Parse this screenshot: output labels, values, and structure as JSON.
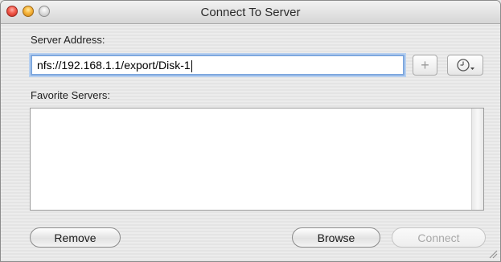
{
  "window": {
    "title": "Connect To Server"
  },
  "server_address": {
    "label": "Server Address:",
    "value": "nfs://192.168.1.1/export/Disk-1",
    "add_label": "+"
  },
  "favorites": {
    "label": "Favorite Servers:",
    "items": []
  },
  "buttons": {
    "remove": "Remove",
    "browse": "Browse",
    "connect": "Connect"
  },
  "icons": {
    "close": "close-icon",
    "minimize": "minimize-icon",
    "zoom": "zoom-icon",
    "recent": "clock-icon",
    "resize": "resize-grip-icon"
  },
  "colors": {
    "focus_ring": "#7fa8de",
    "close": "#f25a4c",
    "minimize": "#f7b53a"
  }
}
